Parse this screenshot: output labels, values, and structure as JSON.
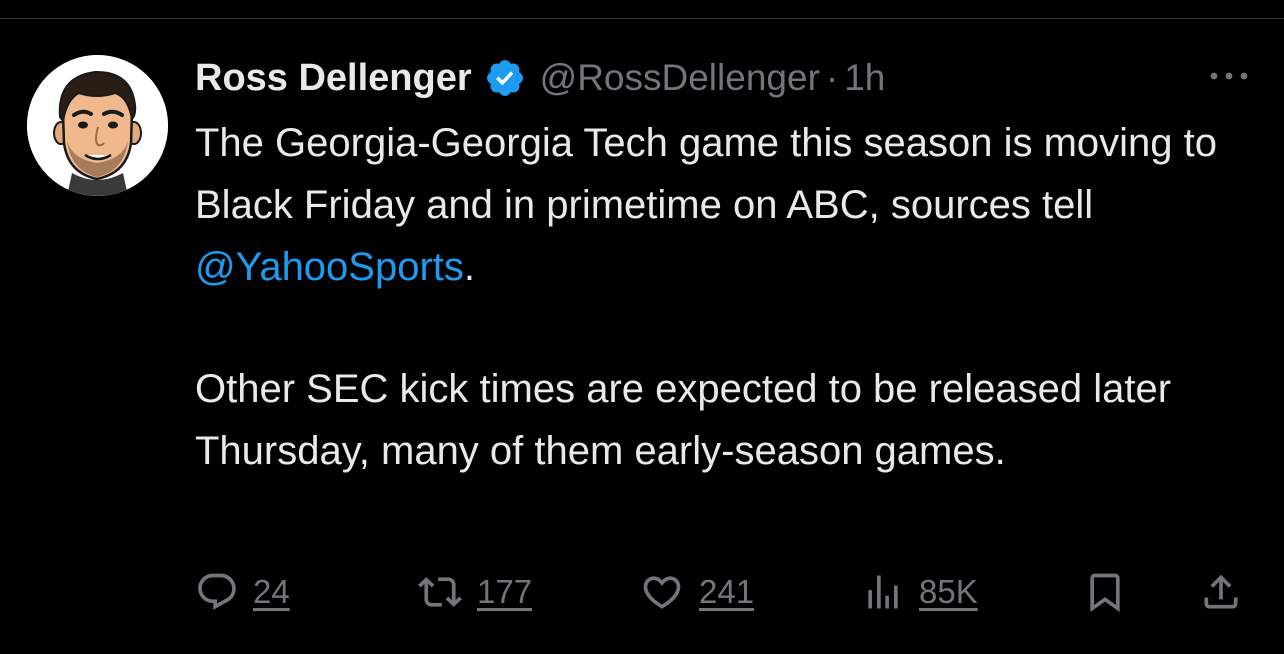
{
  "tweet": {
    "author": {
      "display_name": "Ross Dellenger",
      "handle": "@RossDellenger",
      "verified": true
    },
    "separator": "·",
    "time": "1h",
    "text": {
      "p1_before": "The Georgia-Georgia Tech game this season is moving to Black Friday and in primetime on ABC, sources tell ",
      "mention": "@YahooSports",
      "p1_after": ".",
      "p2": "Other SEC kick times are expected to be released later Thursday, many of them early-season games."
    }
  },
  "actions": {
    "replies": "24",
    "reposts": "177",
    "likes": "241",
    "views": "85K"
  },
  "colors": {
    "background": "#000000",
    "text": "#e7e9ea",
    "secondary": "#71767b",
    "accent": "#1d9bf0"
  },
  "icons": {
    "verified": "verified-badge-icon",
    "more": "more-icon",
    "reply": "reply-icon",
    "repost": "repost-icon",
    "like": "heart-icon",
    "views": "views-icon",
    "bookmark": "bookmark-icon",
    "share": "share-icon"
  }
}
